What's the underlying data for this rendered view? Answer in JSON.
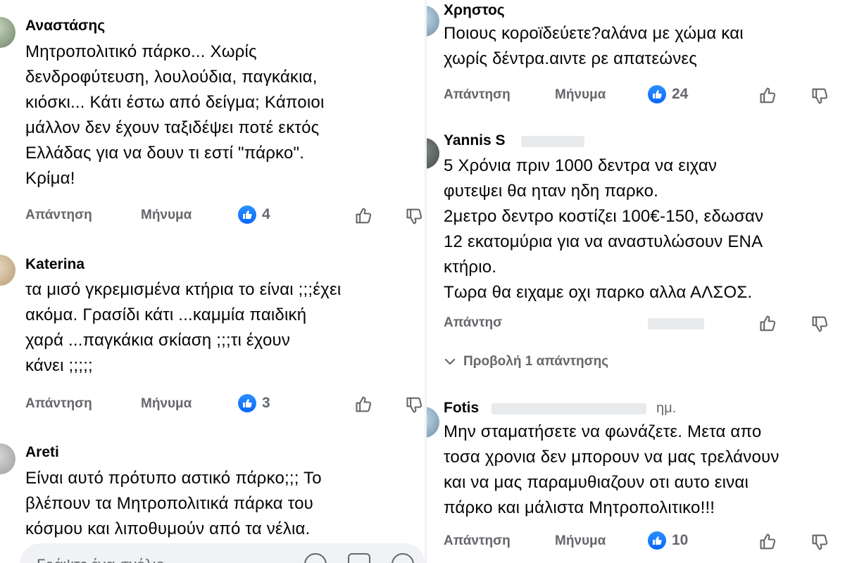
{
  "actions": {
    "reply_label": "Απάντηση",
    "message_label": "Μήνυμα"
  },
  "left_comments": [
    {
      "name": "Αναστάσης",
      "text": "Μητροπολιτικό πάρκο... Χωρίς\nδενδροφύτευση, λουλούδια, παγκάκια,\nκιόσκι... Κάτι έστω από δείγμα; Κάποιοι\nμάλλον δεν έχουν ταξιδέψει ποτέ εκτός\nΕλλάδας για να δουν τι εστί \"πάρκο\".\nΚρίμα!",
      "likes": "4"
    },
    {
      "name": "Katerina",
      "text": "τα μισό γκρεμισμένα κτήρια το είναι ;;;έχει\nακόμα. Γρασίδι κάτι ...καμμία παιδική\nχαρά ...παγκάκια σκίαση ;;;τι έχουν\nκάνει ;;;;;",
      "likes": "3"
    },
    {
      "name": "Areti",
      "text": "Είναι αυτό πρότυπο αστικό πάρκο;;; Το\nβλέπουν τα Μητροπολιτικά πάρκα του\nκόσμου και λιποθυμούν από τα νέλια."
    }
  ],
  "right_comments": [
    {
      "name": "Χρηστος",
      "text": "Ποιους κοροϊδεύετε?αλάνα με χώμα και\nχωρίς δέντρα.αιντε ρε απατεώνες",
      "likes": "24"
    },
    {
      "name": "Yannis S",
      "text": "5 Χρόνια πριν 1000 δεντρα να ειχαν\nφυτεψει θα ηταν ηδη παρκο.\n2μετρο δεντρο κοστίζει 100€-150, εδωσαν\n12 εκατομύρια για να αναστυλώσουν ΕΝΑ\nκτήριο.\nΤωρα θα ειχαμε οχι παρκο αλλα ΑΛΣΟΣ.",
      "reply_partial": "Απάντησ",
      "view_replies": "Προβολή 1 απάντησης"
    },
    {
      "name": "Fotis",
      "name_suffix": "ημ.",
      "text": "Μην σταματήσετε να φωνάζετε. Μετα απο\nτοσα χρονια δεν μπορουν να μας τρελάνουν\nκαι να μας παραμυθιαζουν οτι αυτο ειναι\nπάρκο και μάλιστα Μητροπολιτικο!!!",
      "likes": "10"
    }
  ],
  "composer": {
    "placeholder": "Γράψτε ένα σχόλιο..."
  },
  "colors": {
    "like_blue": "#0866ff",
    "meta_grey": "#65676b",
    "text": "#050505",
    "divider": "#f0f2f5"
  }
}
